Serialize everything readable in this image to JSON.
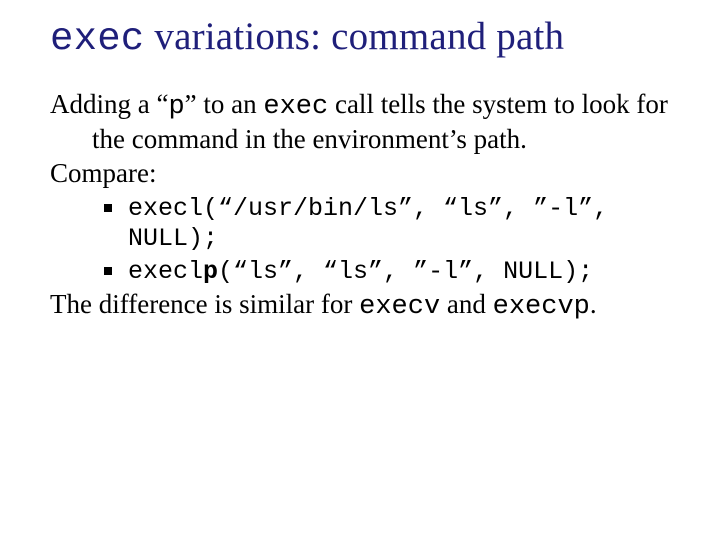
{
  "title": {
    "code": "exec",
    "rest": " variations: command path"
  },
  "para1": {
    "t1": "Adding a “",
    "code1": "p",
    "t2": "” to an ",
    "code2": "exec",
    "t3": " call tells the system to look for the command in the environment’s path."
  },
  "compare_label": "Compare:",
  "code_items": {
    "a": "execl(“/usr/bin/ls”, “ls”, ”-l”, NULL);",
    "b_pre": "execl",
    "b_bold": "p",
    "b_post": "(“ls”, “ls”, ”-l”, NULL);"
  },
  "para2": {
    "t1": "The difference is similar for ",
    "code1": "execv",
    "t2": " and ",
    "code2": "execvp",
    "t3": "."
  }
}
